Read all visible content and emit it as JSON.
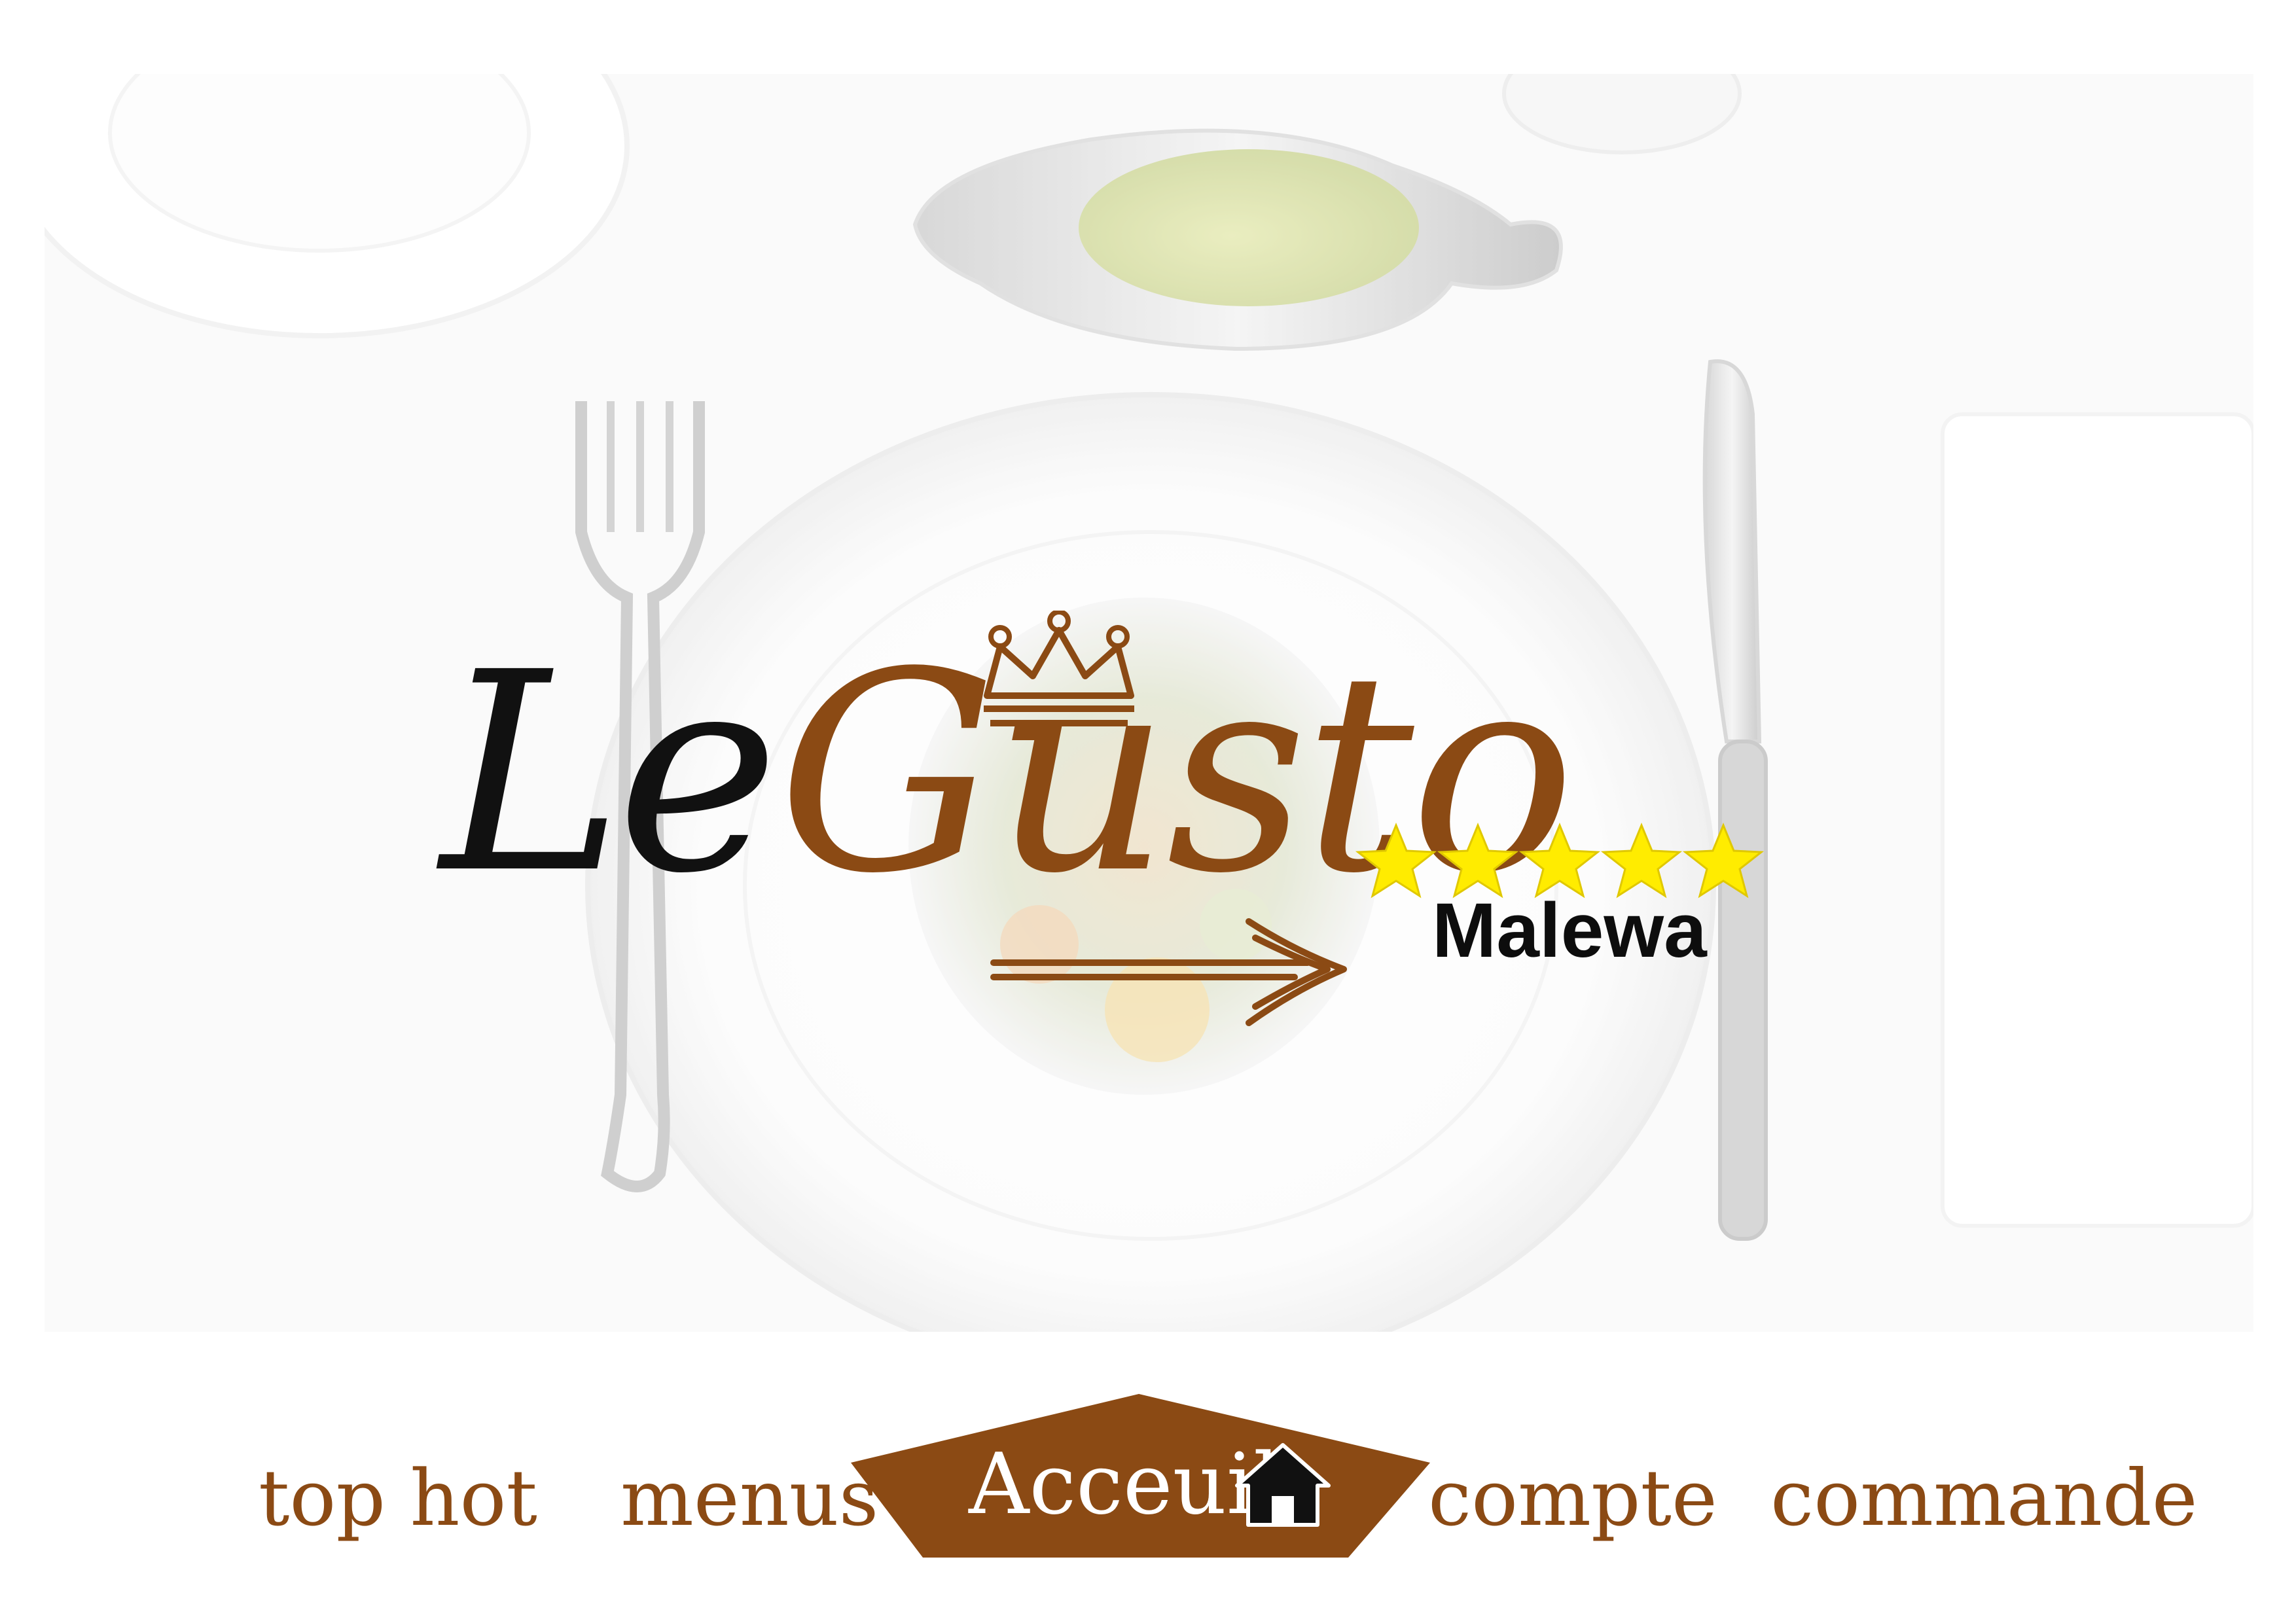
{
  "brand": {
    "word1": "Le",
    "word2": "Gusto",
    "branch": "Malewa",
    "rating_stars": 5,
    "colors": {
      "brown": "#8b4a14",
      "black": "#111111",
      "star": "#ffec00"
    }
  },
  "hero": {
    "image": "table-setting-plate-photo"
  },
  "nav": {
    "items": [
      {
        "label": "top hot"
      },
      {
        "label": "menus"
      },
      {
        "label": "Acceuil",
        "icon": "home-icon",
        "active": true
      },
      {
        "label": "compte"
      },
      {
        "label": "commande"
      }
    ],
    "active_color": "#8b4a14"
  }
}
